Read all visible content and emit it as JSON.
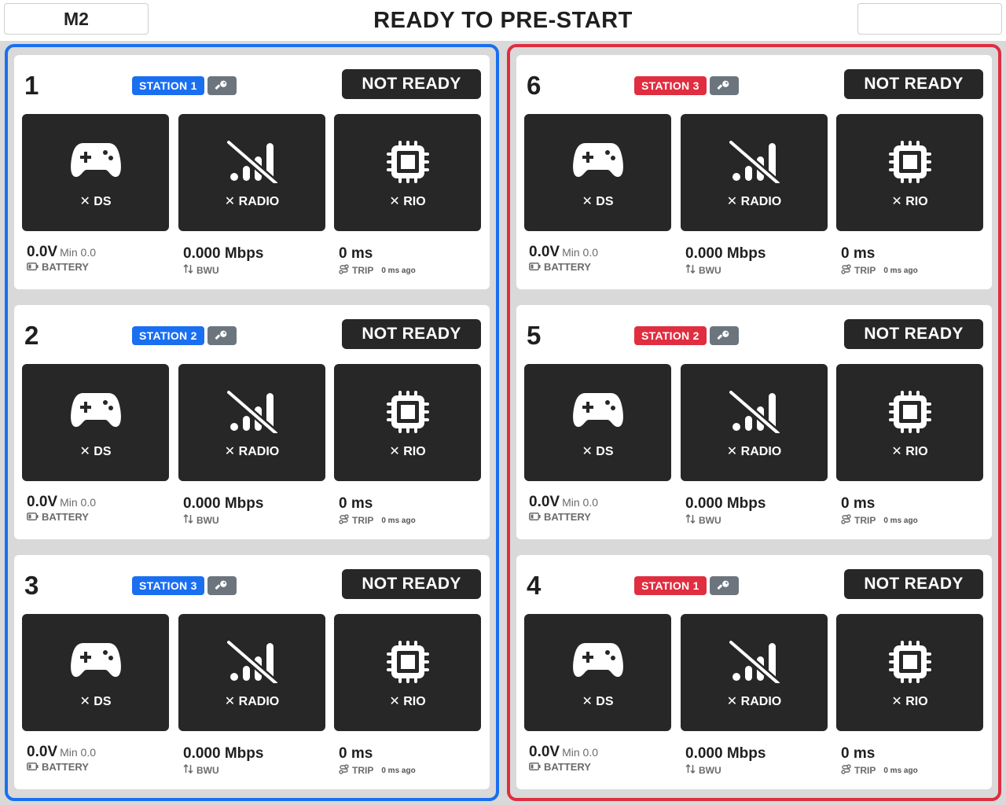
{
  "header": {
    "match": "M2",
    "title": "READY TO PRE-START"
  },
  "tiles": {
    "ds": "✕ DS",
    "radio": "✕ RADIO",
    "rio": "✕ RIO"
  },
  "labels": {
    "not_ready": "NOT READY",
    "battery_value": "0.0V",
    "battery_min": "Min 0.0",
    "battery": "BATTERY",
    "bandwidth_value": "0.000 Mbps",
    "bwu": "BWU",
    "trip_value": "0 ms",
    "trip": "TRIP",
    "trip_ago": "0 ms ago"
  },
  "alliances": {
    "blue": {
      "color": "#1a6ff0",
      "teams": [
        {
          "number": "1",
          "station": "STATION 1"
        },
        {
          "number": "2",
          "station": "STATION 2"
        },
        {
          "number": "3",
          "station": "STATION 3"
        }
      ]
    },
    "red": {
      "color": "#e02d40",
      "teams": [
        {
          "number": "6",
          "station": "STATION 3"
        },
        {
          "number": "5",
          "station": "STATION 2"
        },
        {
          "number": "4",
          "station": "STATION 1"
        }
      ]
    }
  },
  "icons": {
    "ds": "gamepad-icon",
    "radio": "signal-off-icon",
    "rio": "cpu-chip-icon",
    "key": "key-icon",
    "battery": "battery-icon",
    "bandwidth": "arrows-up-down-icon",
    "trip": "route-icon"
  }
}
